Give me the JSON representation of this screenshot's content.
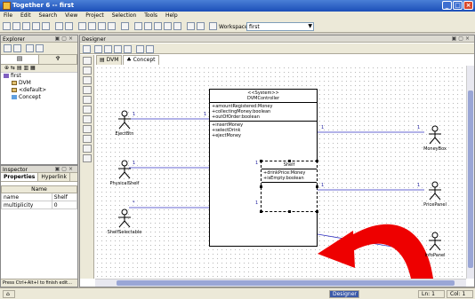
{
  "window": {
    "title": "Together 6 -- first",
    "buttons": [
      "_",
      "□",
      "×"
    ]
  },
  "menu": [
    "File",
    "Edit",
    "Search",
    "View",
    "Project",
    "Selection",
    "Tools",
    "Help"
  ],
  "toolbar": {
    "workspace_label": "Workspace:",
    "workspace_value": "first"
  },
  "explorer": {
    "title": "Explorer",
    "tabs": [
      "▤",
      "♆"
    ],
    "tree": [
      {
        "label": "first",
        "icon": "project-icon",
        "level": 0
      },
      {
        "label": "DVM",
        "icon": "package-icon",
        "level": 1
      },
      {
        "label": "<default>",
        "icon": "package-icon",
        "level": 1
      },
      {
        "label": "Concept",
        "icon": "diagram-icon",
        "level": 1
      }
    ]
  },
  "inspector": {
    "title": "Inspector",
    "tabs": [
      "Properties",
      "Hyperlink"
    ],
    "header": "Name",
    "rows": [
      {
        "key": "name",
        "value": "Shelf"
      },
      {
        "key": "multiplicity",
        "value": "0"
      }
    ],
    "status": "Press Ctrl+Alt+I to finish edit..."
  },
  "designer": {
    "title": "Designer",
    "tabs": [
      "DVM",
      "Concept"
    ],
    "classes": {
      "controller": {
        "stereotype": "<<System>>",
        "name": "DVMController",
        "attributes": [
          "+amountRegistered:Money",
          "+collectingMoney:boolean",
          "+outOfOrder:boolean"
        ],
        "operations": [
          "+insertMoney",
          "+selectDrink",
          "+ejectMoney"
        ]
      },
      "shelf": {
        "name": "Shelf",
        "attributes": [
          "+drinkPrice:Money",
          "+isEmpty:boolean"
        ]
      }
    },
    "actors": [
      {
        "id": "eject",
        "name": "EjectBtn"
      },
      {
        "id": "physical",
        "name": "PhysicalShelf"
      },
      {
        "id": "selectable",
        "name": "ShelfSelectable"
      },
      {
        "id": "money",
        "name": "MoneyBox"
      },
      {
        "id": "price",
        "name": "PricePanel"
      },
      {
        "id": "info",
        "name": "InfoPanel"
      }
    ],
    "multiplicities": [
      "1",
      "1",
      "1",
      "1",
      "1",
      "1",
      "1",
      "1",
      "*",
      "1"
    ]
  },
  "status": {
    "line": "Ln: 1",
    "col": "Col: 1",
    "mode": "Designer"
  },
  "colors": {
    "title_bar": "#1c4fb8",
    "arrow": "#e00000",
    "selection": "#3c5aa8"
  }
}
